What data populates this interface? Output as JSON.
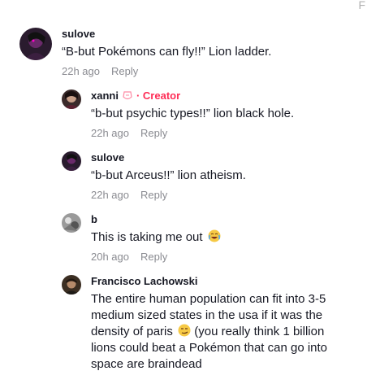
{
  "corner": "F",
  "comments": [
    {
      "username": "sulove",
      "text": "“B-but Pokémons can fly!!” Lion ladder.",
      "time": "22h ago",
      "reply": "Reply"
    },
    {
      "username": "xanni",
      "badge": "· Creator",
      "text": "“b-but psychic types!!” lion black hole.",
      "time": "22h ago",
      "reply": "Reply"
    },
    {
      "username": "sulove",
      "text": "“b-but Arceus!!” lion atheism.",
      "time": "22h ago",
      "reply": "Reply"
    },
    {
      "username": "b",
      "text": "This is taking me out",
      "emoji": "crying-laughing-emoji",
      "time": "20h ago",
      "reply": "Reply"
    },
    {
      "username": "Francisco Lachowski",
      "text_lines": [
        "The entire human population can fit into 3-5",
        "medium sized states in the usa if it was the",
        "density of paris",
        " (you really think 1 billion",
        "lions could beat a Pokémon that can go into",
        "space are braindead"
      ],
      "emoji": "smirk-emoji"
    }
  ],
  "colors": {
    "creator": "#fe2c55",
    "meta": "#8a8b91",
    "text": "#161823"
  }
}
